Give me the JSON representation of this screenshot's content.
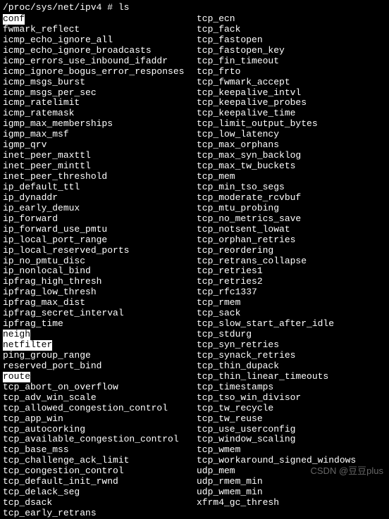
{
  "prompt": "/proc/sys/net/ipv4 # ls",
  "highlighted_dirs": [
    "conf",
    "neigh",
    "netfilter",
    "route"
  ],
  "columns": {
    "left": [
      "conf",
      "fwmark_reflect",
      "icmp_echo_ignore_all",
      "icmp_echo_ignore_broadcasts",
      "icmp_errors_use_inbound_ifaddr",
      "icmp_ignore_bogus_error_responses",
      "icmp_msgs_burst",
      "icmp_msgs_per_sec",
      "icmp_ratelimit",
      "icmp_ratemask",
      "igmp_max_memberships",
      "igmp_max_msf",
      "igmp_qrv",
      "inet_peer_maxttl",
      "inet_peer_minttl",
      "inet_peer_threshold",
      "ip_default_ttl",
      "ip_dynaddr",
      "ip_early_demux",
      "ip_forward",
      "ip_forward_use_pmtu",
      "ip_local_port_range",
      "ip_local_reserved_ports",
      "ip_no_pmtu_disc",
      "ip_nonlocal_bind",
      "ipfrag_high_thresh",
      "ipfrag_low_thresh",
      "ipfrag_max_dist",
      "ipfrag_secret_interval",
      "ipfrag_time",
      "neigh",
      "netfilter",
      "ping_group_range",
      "reserved_port_bind",
      "route",
      "tcp_abort_on_overflow",
      "tcp_adv_win_scale",
      "tcp_allowed_congestion_control",
      "tcp_app_win",
      "tcp_autocorking",
      "tcp_available_congestion_control",
      "tcp_base_mss",
      "tcp_challenge_ack_limit",
      "tcp_congestion_control",
      "tcp_default_init_rwnd",
      "tcp_delack_seg",
      "tcp_dsack",
      "tcp_early_retrans"
    ],
    "right": [
      "tcp_ecn",
      "tcp_fack",
      "tcp_fastopen",
      "tcp_fastopen_key",
      "tcp_fin_timeout",
      "tcp_frto",
      "tcp_fwmark_accept",
      "tcp_keepalive_intvl",
      "tcp_keepalive_probes",
      "tcp_keepalive_time",
      "tcp_limit_output_bytes",
      "tcp_low_latency",
      "tcp_max_orphans",
      "tcp_max_syn_backlog",
      "tcp_max_tw_buckets",
      "tcp_mem",
      "tcp_min_tso_segs",
      "tcp_moderate_rcvbuf",
      "tcp_mtu_probing",
      "tcp_no_metrics_save",
      "tcp_notsent_lowat",
      "tcp_orphan_retries",
      "tcp_reordering",
      "tcp_retrans_collapse",
      "tcp_retries1",
      "tcp_retries2",
      "tcp_rfc1337",
      "tcp_rmem",
      "tcp_sack",
      "tcp_slow_start_after_idle",
      "tcp_stdurg",
      "tcp_syn_retries",
      "tcp_synack_retries",
      "tcp_thin_dupack",
      "tcp_thin_linear_timeouts",
      "tcp_timestamps",
      "tcp_tso_win_divisor",
      "tcp_tw_recycle",
      "tcp_tw_reuse",
      "tcp_use_userconfig",
      "tcp_window_scaling",
      "tcp_wmem",
      "tcp_workaround_signed_windows",
      "udp_mem",
      "udp_rmem_min",
      "udp_wmem_min",
      "xfrm4_gc_thresh"
    ]
  },
  "watermark": "CSDN @豆豆plus"
}
